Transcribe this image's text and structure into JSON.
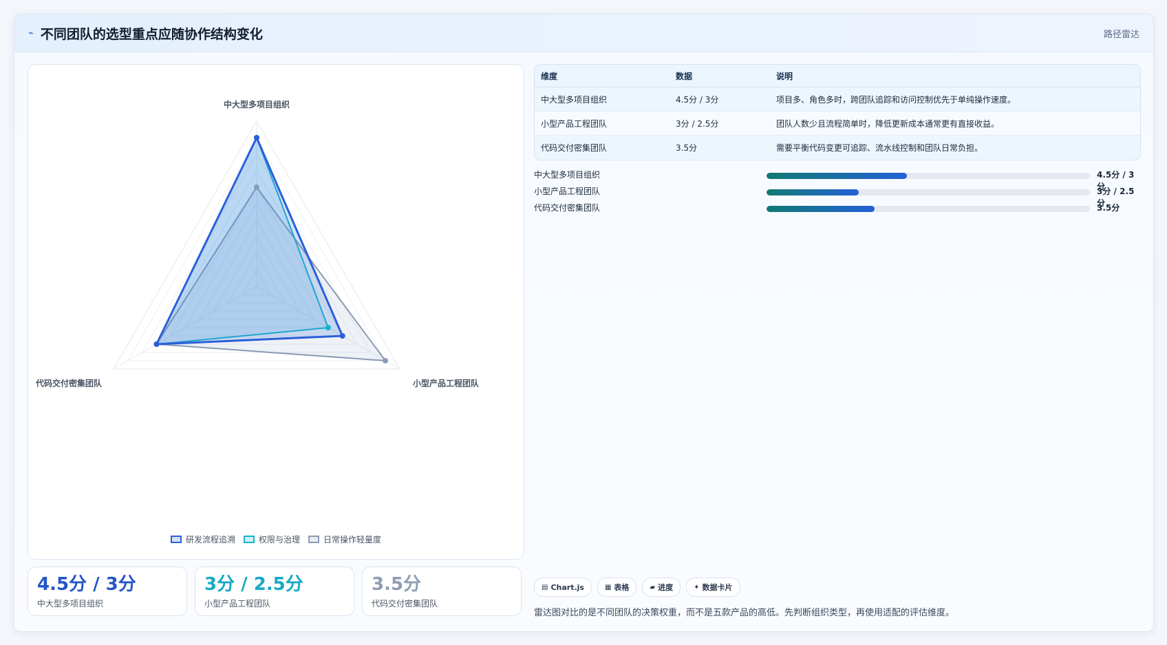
{
  "header": {
    "title": "不同团队的选型重点应随协作结构变化",
    "tag": "路径雷达"
  },
  "chart_data": {
    "type": "radar",
    "axes": [
      "中大型多项目组织",
      "小型产品工程团队",
      "代码交付密集团队"
    ],
    "range": [
      0,
      5
    ],
    "series": [
      {
        "name": "研发流程追溯",
        "color": "#2b5fd9",
        "values": [
          4.5,
          3,
          3.5
        ]
      },
      {
        "name": "权限与治理",
        "color": "#17b3cc",
        "values": [
          4.5,
          2.5,
          3.5
        ]
      },
      {
        "name": "日常操作轻量度",
        "color": "#8a9bb5",
        "values": [
          3,
          4.5,
          3.5
        ]
      }
    ]
  },
  "stats": [
    {
      "value": "4.5分 / 3分",
      "label": "中大型多项目组织",
      "color": "#2456c8"
    },
    {
      "value": "3分 / 2.5分",
      "label": "小型产品工程团队",
      "color": "#17a9c4"
    },
    {
      "value": "3.5分",
      "label": "代码交付密集团队",
      "color": "#8e9db3"
    }
  ],
  "table": {
    "headers": [
      "维度",
      "数据",
      "说明"
    ],
    "rows": [
      [
        "中大型多项目组织",
        "4.5分 / 3分",
        "项目多、角色多时，跨团队追踪和访问控制优先于单纯操作速度。"
      ],
      [
        "小型产品工程团队",
        "3分 / 2.5分",
        "团队人数少且流程简单时，降低更新成本通常更有直接收益。"
      ],
      [
        "代码交付密集团队",
        "3.5分",
        "需要平衡代码变更可追踪、流水线控制和团队日常负担。"
      ]
    ]
  },
  "progress": [
    {
      "label": "中大型多项目组织",
      "value": "4.5分 / 3分",
      "fraction": 0.435
    },
    {
      "label": "小型产品工程团队",
      "value": "3分 / 2.5分",
      "fraction": 0.285
    },
    {
      "label": "代码交付密集团队",
      "value": "3.5分",
      "fraction": 0.335
    }
  ],
  "chips": [
    {
      "icon": "chart-icon",
      "glyph": "▤",
      "label": "Chart.js"
    },
    {
      "icon": "table-icon",
      "glyph": "▦",
      "label": "表格"
    },
    {
      "icon": "progress-icon",
      "glyph": "▰",
      "label": "进度"
    },
    {
      "icon": "card-icon",
      "glyph": "✦",
      "label": "数据卡片"
    }
  ],
  "note": "雷达图对比的是不同团队的决策权重，而不是五款产品的高低。先判断组织类型，再使用适配的评估维度。"
}
